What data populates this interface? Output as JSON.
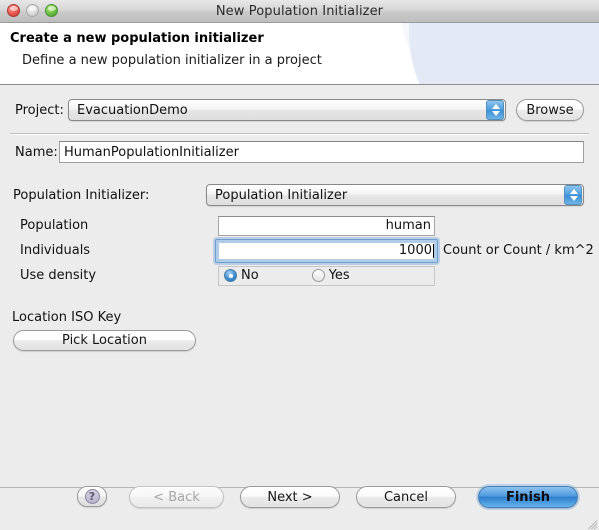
{
  "window": {
    "title": "New Population Initializer",
    "traffic_lights": [
      {
        "name": "close",
        "color": "#ef5f54"
      },
      {
        "name": "minimize",
        "color": "#dcdcdc"
      },
      {
        "name": "zoom",
        "color": "#74c544"
      }
    ]
  },
  "header": {
    "title": "Create a new population initializer",
    "subtitle": "Define a new population initializer in a project"
  },
  "form": {
    "project": {
      "label": "Project:",
      "value": "EvacuationDemo",
      "browse_label": "Browse"
    },
    "name": {
      "label": "Name:",
      "value": "HumanPopulationInitializer",
      "placeholder": ""
    },
    "population_initializer": {
      "label": "Population Initializer:",
      "value": "Population Initializer"
    },
    "properties": [
      {
        "label": "Population",
        "value": "human",
        "suffix": "",
        "focused": false
      },
      {
        "label": "Individuals",
        "value": "1000",
        "suffix": "Count or Count / km^2",
        "focused": true
      }
    ],
    "use_density": {
      "label": "Use density",
      "options": [
        {
          "label": "No",
          "selected": true
        },
        {
          "label": "Yes",
          "selected": false
        }
      ]
    },
    "location_iso_key": {
      "label": "Location ISO Key",
      "button_label": "Pick Location"
    }
  },
  "footer": {
    "help_label": "?",
    "back_label": "< Back",
    "next_label": "Next >",
    "cancel_label": "Cancel",
    "finish_label": "Finish"
  },
  "colors": {
    "accent": "#3d8ed2",
    "window_bg": "#ececec",
    "header_bg": "#ffffff"
  }
}
